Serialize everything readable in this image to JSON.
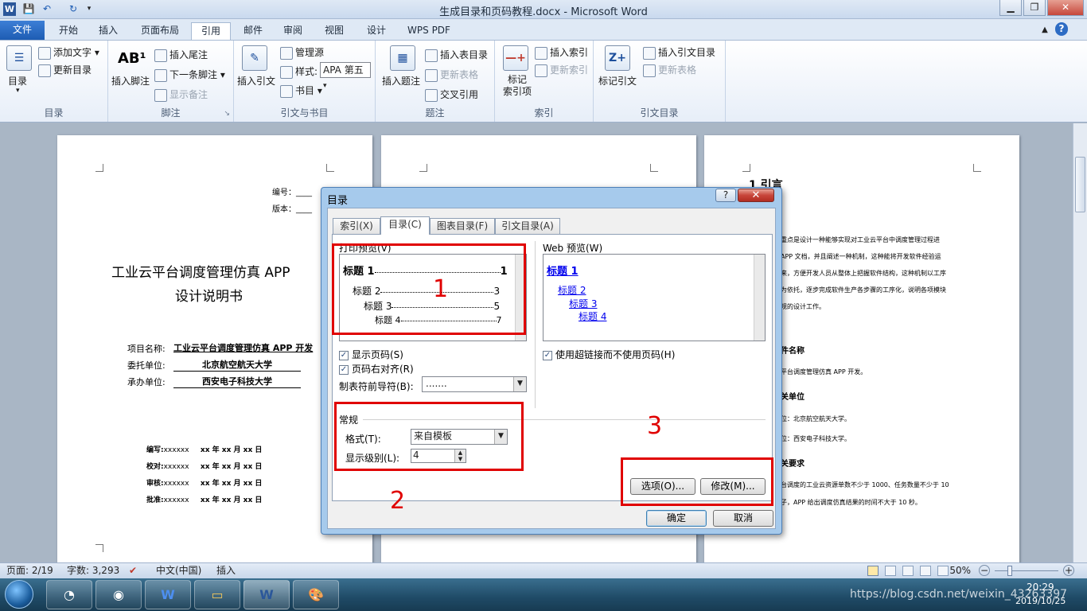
{
  "window": {
    "title": "生成目录和页码教程.docx  -  Microsoft Word"
  },
  "tabs": [
    {
      "label": "文件"
    },
    {
      "label": "开始"
    },
    {
      "label": "插入"
    },
    {
      "label": "页面布局"
    },
    {
      "label": "引用"
    },
    {
      "label": "邮件"
    },
    {
      "label": "审阅"
    },
    {
      "label": "视图"
    },
    {
      "label": "设计"
    },
    {
      "label": "WPS PDF"
    }
  ],
  "ribbon": {
    "toc_group": {
      "label": "目录",
      "toc_btn": "目录",
      "add_text": "添加文字",
      "update_toc": "更新目录"
    },
    "footnote_group": {
      "label": "脚注",
      "insert_footnote": "插入脚注",
      "insert_endnote": "插入尾注",
      "next_footnote": "下一条脚注",
      "show_notes": "显示备注"
    },
    "citation_group": {
      "label": "引文与书目",
      "insert_citation": "插入引文",
      "manage_sources": "管理源",
      "style_label": "样式:",
      "style_value": "APA 第五",
      "bibliography": "书目"
    },
    "caption_group": {
      "label": "题注",
      "insert_caption": "插入题注",
      "insert_table_of_figures": "插入表目录",
      "update_table": "更新表格",
      "cross_ref": "交叉引用"
    },
    "index_group": {
      "label": "索引",
      "mark_entry": "标记\n索引项",
      "insert_index": "插入索引",
      "update_index": "更新索引"
    },
    "toa_group": {
      "label": "引文目录",
      "mark_citation": "标记引文",
      "insert_toa": "插入引文目录",
      "update_table": "更新表格"
    }
  },
  "document": {
    "page1": {
      "number_label": "编号：",
      "version_label": "版本：",
      "title_line1": "工业云平台调度管理仿真  APP",
      "title_line2": "设计说明书",
      "project_label": "项目名称:",
      "project_value": "工业云平台调度管理仿真  APP  开发",
      "client_label": "委托单位:",
      "client_value": "北京航空航天大学",
      "contractor_label": "承办单位:",
      "contractor_value": "西安电子科技大学",
      "sign_rows": [
        {
          "role": "编写:",
          "name": "xxxxxx",
          "date": "xx  年  xx  月  xx  日"
        },
        {
          "role": "校对:",
          "name": "xxxxxx",
          "date": "xx  年  xx  月  xx  日"
        },
        {
          "role": "审核:",
          "name": "xxxxxx",
          "date": "xx  年  xx  月  xx  日"
        },
        {
          "role": "批准:",
          "name": "xxxxxx",
          "date": "xx  年  xx  月  xx  日"
        }
      ]
    },
    "page3": {
      "heading": "1 引言",
      "lines": [
        "重点是设计一种能够实现对工业云平台中调度管理过程进",
        "APP  文档，并且阐述一种机制，这种能将开发软件经验运",
        "来，方便开发人员从整体上把握软件结构，这种机制以工序",
        "为依托，逐步完成软件生产各步骤的工序化，说明各项模块",
        "规的设计工作。"
      ],
      "sec_name": "件名称",
      "sec_name_line": "平台调度管理仿真  APP  开发。",
      "sec_org": "关单位",
      "sec_org_line1": "位：北京航空航天大学。",
      "sec_org_line2": "位：西安电子科技大学。",
      "sec_req": "关要求",
      "sec_req_line1": "台调度的工业云资源单数不少于 1000、任务数量不少于  10",
      "sec_req_line2": "子，APP  给出调度仿真结果的时间不大于   10  秒。"
    }
  },
  "dialog": {
    "title": "目录",
    "help": "?",
    "close": "✕",
    "tabs": [
      {
        "label": "索引(X)"
      },
      {
        "label": "目录(C)"
      },
      {
        "label": "图表目录(F)"
      },
      {
        "label": "引文目录(A)"
      }
    ],
    "print_preview_label": "打印预览(V)",
    "print_preview": [
      {
        "text": "标题 1",
        "page": "1"
      },
      {
        "text": "标题 2",
        "page": "3"
      },
      {
        "text": "标题 3",
        "page": "5"
      },
      {
        "text": "标题 4",
        "page": "7"
      }
    ],
    "web_preview_label": "Web 预览(W)",
    "web_preview": [
      "标题 1",
      "标题 2",
      "标题 3",
      "标题 4"
    ],
    "show_page_numbers": "显示页码(S)",
    "right_align": "页码右对齐(R)",
    "tab_leader_label": "制表符前导符(B):",
    "tab_leader_value": ".......",
    "use_hyperlinks": "使用超链接而不使用页码(H)",
    "general_label": "常规",
    "format_label": "格式(T):",
    "format_value": "来自模板",
    "levels_label": "显示级别(L):",
    "levels_value": "4",
    "options_btn": "选项(O)...",
    "modify_btn": "修改(M)...",
    "ok_btn": "确定",
    "cancel_btn": "取消"
  },
  "annotations": [
    "1",
    "2",
    "3"
  ],
  "statusbar": {
    "page": "页面: 2/19",
    "words": "字数: 3,293",
    "language": "中文(中国)",
    "mode": "插入",
    "zoom": "50%"
  },
  "taskbar": {
    "time": "20:29",
    "date": "2019/10/25",
    "watermark": "https://blog.csdn.net/weixin_43263397"
  }
}
